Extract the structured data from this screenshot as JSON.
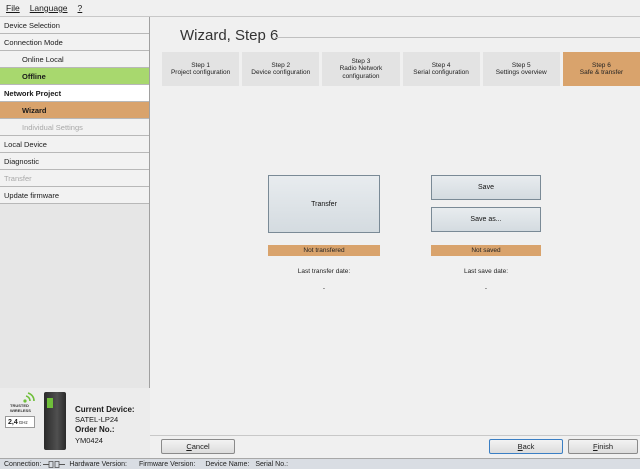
{
  "menu": {
    "file": "File",
    "language": "Language",
    "help": "?"
  },
  "sidebar": {
    "device_selection": "Device Selection",
    "connection_mode": "Connection Mode",
    "online_local": "Online Local",
    "offline": "Offline",
    "network_project": "Network Project",
    "wizard": "Wizard",
    "individual_settings": "Individual Settings",
    "local_device": "Local Device",
    "diagnostic": "Diagnostic",
    "transfer": "Transfer",
    "update_firmware": "Update firmware"
  },
  "device": {
    "logo_text_1": "TRUSTED",
    "logo_text_2": "WIRELESS",
    "band": "2,4",
    "band_unit": "GHz",
    "current_device_label": "Current Device:",
    "current_device_value": "SATEL-LP24",
    "order_no_label": "Order No.:",
    "order_no_value": "YM0424"
  },
  "main": {
    "title": "Wizard, Step 6",
    "steps": [
      {
        "line1": "Step 1",
        "line2": "Project configuration",
        "line3": ""
      },
      {
        "line1": "Step 2",
        "line2": "Device configuration",
        "line3": ""
      },
      {
        "line1": "Step 3",
        "line2": "Radio Network",
        "line3": "configuration"
      },
      {
        "line1": "Step 4",
        "line2": "Serial configuration",
        "line3": ""
      },
      {
        "line1": "Step 5",
        "line2": "Settings overview",
        "line3": ""
      },
      {
        "line1": "Step 6",
        "line2": "Safe & transfer",
        "line3": ""
      }
    ],
    "transfer_button": "Transfer",
    "transfer_status": "Not transfered",
    "last_transfer_label": "Last transfer date:",
    "last_transfer_value": "-",
    "save_button": "Save",
    "save_as_button": "Save as...",
    "save_status": "Not saved",
    "last_save_label": "Last save date:",
    "last_save_value": "-",
    "cancel_first": "C",
    "cancel_rest": "ancel",
    "back_first": "B",
    "back_rest": "ack",
    "finish_first": "F",
    "finish_rest": "inish"
  },
  "statusbar": {
    "connection": "Connection:",
    "hardware": "Hardware Version:",
    "firmware": "Firmware Version:",
    "device_name": "Device Name:",
    "serial": "Serial No.:"
  },
  "colors": {
    "accent_orange": "#d9a36c",
    "accent_green": "#a8d86e"
  }
}
